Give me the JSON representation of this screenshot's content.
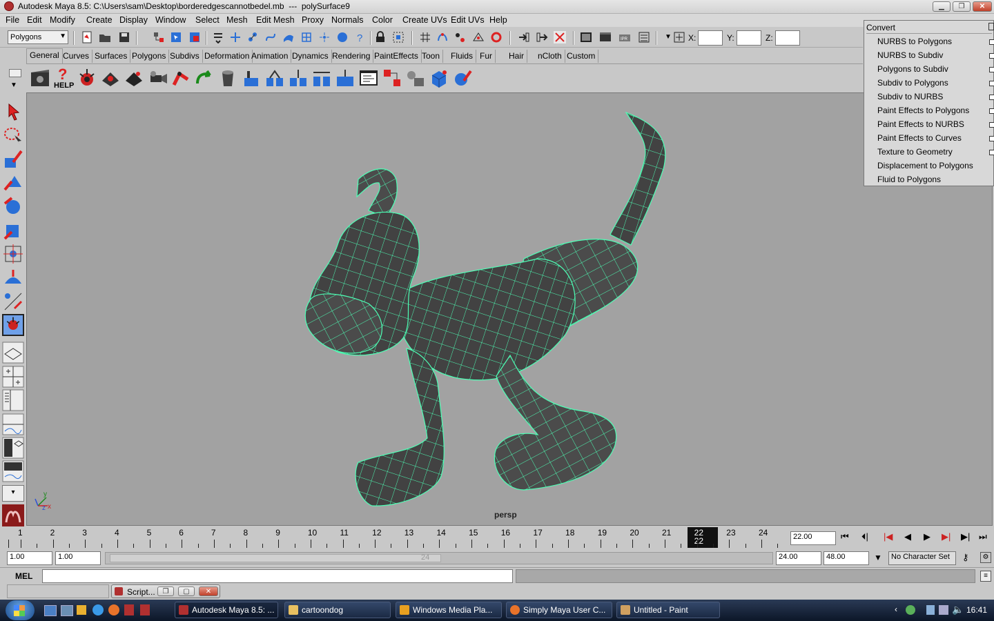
{
  "window": {
    "title": "Autodesk Maya 8.5: C:\\Users\\sam\\Desktop\\borderedgescannotbedel.mb  ---  polySurface9"
  },
  "menubar": [
    "File",
    "Edit",
    "Modify",
    "Create",
    "Display",
    "Window",
    "Select",
    "Mesh",
    "Edit Mesh",
    "Proxy",
    "Normals",
    "Color",
    "Create UVs",
    "Edit UVs",
    "Help"
  ],
  "statusline": {
    "mode": "Polygons",
    "x_label": "X:",
    "y_label": "Y:",
    "z_label": "Z:"
  },
  "shelf_tabs": [
    "General",
    "Curves",
    "Surfaces",
    "Polygons",
    "Subdivs",
    "Deformation",
    "Animation",
    "Dynamics",
    "Rendering",
    "PaintEffects",
    "Toon",
    "Fluids",
    "Fur",
    "Hair",
    "nCloth",
    "Custom"
  ],
  "shelf_help": "HELP",
  "viewport": {
    "camera": "persp",
    "axis_x": "x",
    "axis_y": "y",
    "axis_z": "z"
  },
  "convert_menu": {
    "title": "Convert",
    "items": [
      {
        "label": "NURBS to Polygons",
        "option": true
      },
      {
        "label": "NURBS to Subdiv",
        "option": true
      },
      {
        "label": "Polygons to Subdiv",
        "option": true
      },
      {
        "label": "Subdiv to Polygons",
        "option": true
      },
      {
        "label": "Subdiv to NURBS",
        "option": true
      },
      {
        "label": "Paint Effects to Polygons",
        "option": true
      },
      {
        "label": "Paint Effects to NURBS",
        "option": true
      },
      {
        "label": "Paint Effects to Curves",
        "option": true
      },
      {
        "label": "Texture to Geometry",
        "option": true
      },
      {
        "label": "Displacement to Polygons",
        "option": false
      },
      {
        "label": "Fluid to Polygons",
        "option": false
      }
    ]
  },
  "timeline": {
    "frames": [
      "1",
      "2",
      "3",
      "4",
      "5",
      "6",
      "7",
      "8",
      "9",
      "10",
      "11",
      "12",
      "13",
      "14",
      "15",
      "16",
      "17",
      "18",
      "19",
      "20",
      "21",
      "22",
      "23",
      "24"
    ],
    "current_frame": "22",
    "current_time": "22.00"
  },
  "range": {
    "start_time": "1.00",
    "playback_start": "1.00",
    "range_end_marker": "24",
    "playback_end": "24.00",
    "end_time": "48.00",
    "character_set": "No Character Set"
  },
  "command_line": {
    "label": "MEL"
  },
  "script_window": {
    "label": "Script..."
  },
  "taskbar": {
    "tasks": [
      "Autodesk Maya 8.5: ...",
      "cartoondog",
      "Windows Media Pla...",
      "Simply Maya User C...",
      "Untitled - Paint"
    ],
    "clock": "16:41"
  },
  "colors": {
    "viewport_bg": "#a2a2a2",
    "wire": "#4dffb5",
    "mesh": "#4a4a4a",
    "taskbar": "#1b2a44"
  }
}
